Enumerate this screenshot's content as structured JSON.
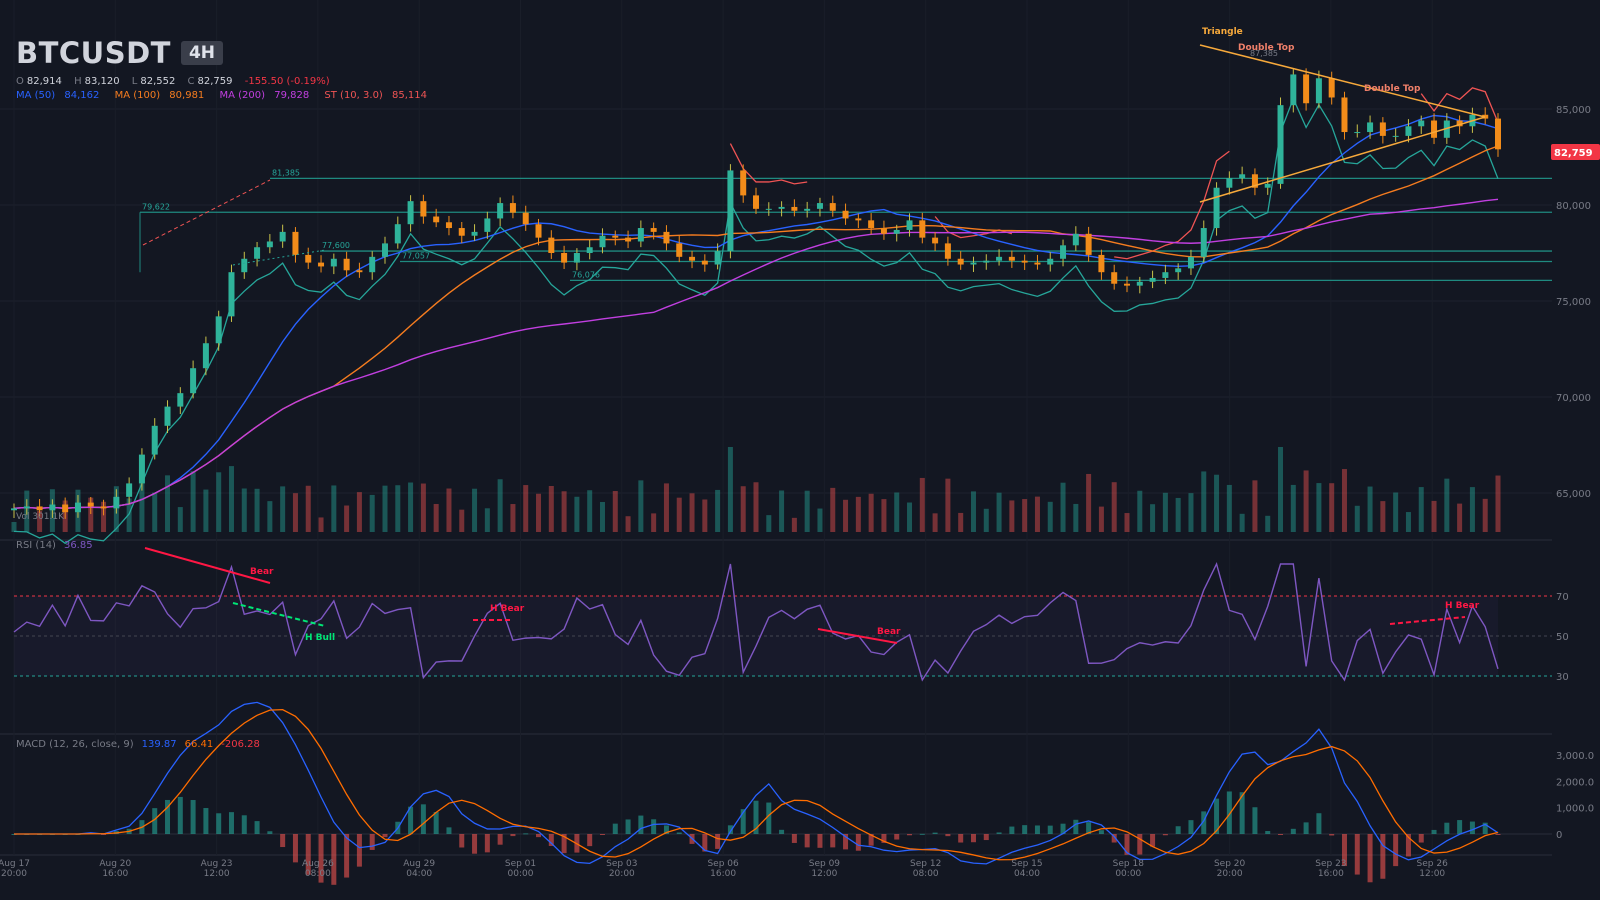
{
  "header": {
    "symbol": "BTCUSDT",
    "timeframe": "4H",
    "ohlc": {
      "o_label": "O",
      "o": "82,914",
      "h_label": "H",
      "h": "83,120",
      "l_label": "L",
      "l": "82,552",
      "c_label": "C",
      "c": "82,759",
      "change": "-155.50 (-0.19%)"
    },
    "indicators": [
      {
        "name": "MA (50)",
        "value": "84,162",
        "color": "#2962ff"
      },
      {
        "name": "MA (100)",
        "value": "80,981",
        "color": "#f57c1f"
      },
      {
        "name": "MA (200)",
        "value": "79,828",
        "color": "#c13fe0"
      },
      {
        "name": "ST (10, 3.0)",
        "value": "85,114",
        "color": "#f05454"
      }
    ]
  },
  "colors": {
    "bg": "#131722",
    "up": "#26a69a",
    "down": "#ef5350",
    "ma50": "#2962ff",
    "ma100": "#f57c1f",
    "ma200": "#c13fe0",
    "rsi": "#7e57c2",
    "macd": "#2962ff",
    "signal": "#ff6d00",
    "pattern": "#f7a93b",
    "bull": "#00e676",
    "bear": "#ff1744"
  },
  "price_axis": {
    "ticks": [
      "85,000",
      "80,000",
      "75,000",
      "70,000",
      "65,000"
    ],
    "values": [
      85000,
      80000,
      75000,
      70000,
      65000
    ],
    "current_price": "82,759"
  },
  "time_axis": {
    "labels": [
      [
        "Aug 17",
        "20:00"
      ],
      [
        "Aug 20",
        "16:00"
      ],
      [
        "Aug 23",
        "12:00"
      ],
      [
        "Aug 26",
        "08:00"
      ],
      [
        "Aug 29",
        "04:00"
      ],
      [
        "Sep 01",
        "00:00"
      ],
      [
        "Sep 03",
        "20:00"
      ],
      [
        "Sep 06",
        "16:00"
      ],
      [
        "Sep 09",
        "12:00"
      ],
      [
        "Sep 12",
        "08:00"
      ],
      [
        "Sep 15",
        "04:00"
      ],
      [
        "Sep 18",
        "00:00"
      ],
      [
        "Sep 20",
        "20:00"
      ],
      [
        "Sep 23",
        "16:00"
      ],
      [
        "Sep 26",
        "12:00"
      ]
    ]
  },
  "annotations": {
    "triangle": "Triangle",
    "double_top_1": "Double Top",
    "double_top_2": "Double Top",
    "peak_87": "87,385",
    "level_81": "81,385",
    "level_79": "79,622",
    "level_77": "77,600",
    "level_77b": "77,057",
    "level_76": "76,076",
    "volume_label": "Vol 301.1K"
  },
  "rsi": {
    "title": "RSI (14)",
    "value": "36.85",
    "levels": [
      "70",
      "50",
      "30"
    ],
    "level_values": [
      70,
      50,
      30
    ],
    "divergences": [
      {
        "label": "Bear"
      },
      {
        "label": "H Bull"
      },
      {
        "label": "H Bear"
      },
      {
        "label": "Bear"
      },
      {
        "label": "H Bear"
      }
    ]
  },
  "macd": {
    "title": "MACD (12, 26, close, 9)",
    "macd_value": "139.87",
    "signal_value": "66.41",
    "hist_value": "-206.28",
    "ticks": [
      "3,000.0",
      "2,000.0",
      "1,000.0",
      "0"
    ],
    "tick_values": [
      3000,
      2000,
      1000,
      0
    ]
  },
  "chart_data": {
    "type": "candlestick",
    "title": "BTCUSDT 4H",
    "ylabel": "",
    "ylim": [
      62500,
      90000
    ],
    "approx_closes": [
      64200,
      64300,
      64100,
      64400,
      64000,
      64500,
      64300,
      64200,
      64800,
      65500,
      67000,
      68500,
      69500,
      70200,
      71500,
      72800,
      74200,
      76500,
      77200,
      77800,
      78100,
      78600,
      77400,
      77000,
      76800,
      77200,
      76600,
      76500,
      77300,
      78000,
      79000,
      80200,
      79400,
      79100,
      78800,
      78400,
      78600,
      79300,
      80100,
      79600,
      79000,
      78300,
      77500,
      77000,
      77500,
      77800,
      78400,
      78300,
      78100,
      78800,
      78600,
      78000,
      77300,
      77100,
      76900,
      77600,
      81800,
      80500,
      79800,
      79800,
      79900,
      79700,
      79800,
      80100,
      79700,
      79300,
      79200,
      78800,
      78500,
      78700,
      79200,
      78300,
      78000,
      77200,
      76900,
      77000,
      77100,
      77300,
      77100,
      77000,
      76900,
      77200,
      77900,
      78500,
      77400,
      76500,
      75900,
      75800,
      76000,
      76200,
      76500,
      76700,
      77300,
      78800,
      80900,
      81400,
      81600,
      80900,
      81100,
      85200,
      86800,
      85300,
      86600,
      85600,
      83800,
      83800,
      84300,
      83600,
      83600,
      84100,
      84400,
      83500,
      84400,
      84100,
      84700,
      84500,
      82900
    ],
    "series": [
      {
        "name": "MA (50)",
        "last": 84162
      },
      {
        "name": "MA (100)",
        "last": 80981
      },
      {
        "name": "MA (200)",
        "last": 79828
      },
      {
        "name": "ST (10, 3.0)",
        "last": 85114
      }
    ],
    "horizontal_levels": [
      81385,
      79622,
      77600,
      77057,
      76076
    ],
    "rsi": {
      "ylim": [
        20,
        90
      ],
      "last": 36.85
    },
    "macd": {
      "ylim": [
        -700,
        3500
      ],
      "macd_last": 139.87,
      "signal_last": 66.41,
      "hist_last": -206.28
    }
  }
}
